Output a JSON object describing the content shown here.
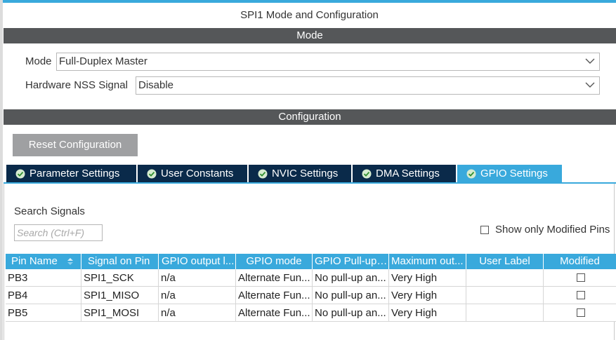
{
  "window": {
    "title": "SPI1 Mode and Configuration"
  },
  "mode_section": {
    "header": "Mode",
    "mode_label": "Mode",
    "mode_value": "Full-Duplex Master",
    "nss_label": "Hardware NSS Signal",
    "nss_value": "Disable"
  },
  "config_section": {
    "header": "Configuration",
    "reset_button": "Reset Configuration",
    "tabs": [
      {
        "label": "Parameter Settings"
      },
      {
        "label": "User Constants"
      },
      {
        "label": "NVIC Settings"
      },
      {
        "label": "DMA Settings"
      },
      {
        "label": "GPIO Settings"
      }
    ],
    "active_tab": "GPIO Settings"
  },
  "gpio": {
    "search_label": "Search Signals",
    "search_placeholder": "Search (Ctrl+F)",
    "show_modified_label": "Show only Modified Pins",
    "columns": [
      "Pin Name",
      "Signal on Pin",
      "GPIO output l...",
      "GPIO mode",
      "GPIO Pull-up/...",
      "Maximum out...",
      "User Label",
      "Modified"
    ],
    "rows": [
      {
        "pin": "PB3",
        "signal": "SPI1_SCK",
        "output": "n/a",
        "mode": "Alternate Fun...",
        "pull": "No pull-up an...",
        "speed": "Very High",
        "label": ""
      },
      {
        "pin": "PB4",
        "signal": "SPI1_MISO",
        "output": "n/a",
        "mode": "Alternate Fun...",
        "pull": "No pull-up an...",
        "speed": "Very High",
        "label": ""
      },
      {
        "pin": "PB5",
        "signal": "SPI1_MOSI",
        "output": "n/a",
        "mode": "Alternate Fun...",
        "pull": "No pull-up an...",
        "speed": "Very High",
        "label": ""
      }
    ]
  },
  "colors": {
    "accent": "#39a9dc",
    "section_bar": "#555759",
    "tab_dark": "#0a2a4a",
    "button_gray": "#9fa0a2"
  },
  "icons": {
    "tab_status": "check-circle-icon",
    "dropdown": "chevron-down-icon",
    "sort": "sort-icon"
  }
}
